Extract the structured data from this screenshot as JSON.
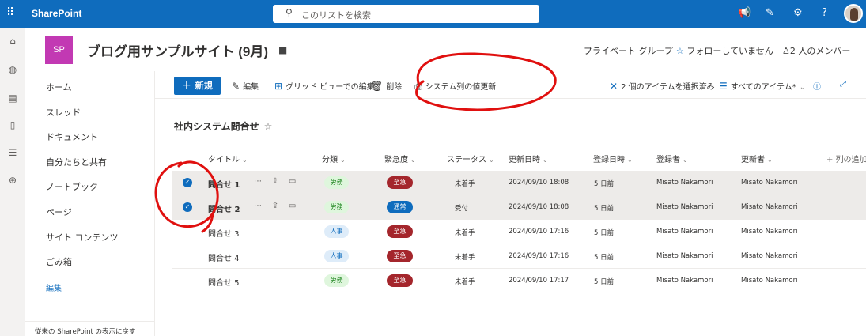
{
  "topbar": {
    "brand": "SharePoint",
    "search_placeholder": "このリストを検索",
    "color": "#0f6cbd"
  },
  "site": {
    "logo_text": "SP",
    "title": "ブログ用サンプルサイト (9月)",
    "group_label": "プライベート グループ",
    "follow_label": "フォローしていません",
    "members_label": "2 人のメンバー"
  },
  "nav": {
    "items": [
      "ホーム",
      "スレッド",
      "ドキュメント",
      "自分たちと共有",
      "ノートブック",
      "ページ",
      "サイト コンテンツ",
      "ごみ箱"
    ],
    "edit_label": "編集",
    "classic_link": "従来の SharePoint の表示に戻す"
  },
  "commands": {
    "new_label": "新規",
    "edit_label": "編集",
    "grid_label": "グリッド ビューでの編集",
    "delete_label": "削除",
    "system_label": "システム列の値更新",
    "selected_label": "2 個のアイテムを選択済み",
    "view_label": "すべてのアイテム*"
  },
  "list": {
    "title": "社内システム問合せ",
    "columns": {
      "title": "タイトル",
      "category": "分類",
      "urgency": "緊急度",
      "status": "ステータス",
      "modified": "更新日時",
      "created": "登録日時",
      "author": "登録者",
      "editor": "更新者",
      "add": "列の追加"
    },
    "rows": [
      {
        "title": "問合せ 1",
        "category": "労務",
        "urgency": "至急",
        "status": "未着手",
        "modified": "2024/09/10 18:08",
        "created": "5 日前",
        "author": "Misato Nakamori",
        "editor": "Misato Nakamori",
        "selected": true
      },
      {
        "title": "問合せ 2",
        "category": "労務",
        "urgency": "通常",
        "status": "受付",
        "modified": "2024/09/10 18:08",
        "created": "5 日前",
        "author": "Misato Nakamori",
        "editor": "Misato Nakamori",
        "selected": true
      },
      {
        "title": "問合せ 3",
        "category": "人事",
        "urgency": "至急",
        "status": "未着手",
        "modified": "2024/09/10 17:16",
        "created": "5 日前",
        "author": "Misato Nakamori",
        "editor": "Misato Nakamori",
        "selected": false
      },
      {
        "title": "問合せ 4",
        "category": "人事",
        "urgency": "至急",
        "status": "未着手",
        "modified": "2024/09/10 17:16",
        "created": "5 日前",
        "author": "Misato Nakamori",
        "editor": "Misato Nakamori",
        "selected": false
      },
      {
        "title": "問合せ 5",
        "category": "労務",
        "urgency": "至急",
        "status": "未着手",
        "modified": "2024/09/10 17:17",
        "created": "5 日前",
        "author": "Misato Nakamori",
        "editor": "Misato Nakamori",
        "selected": false
      }
    ]
  },
  "colors": {
    "roumu_bg": "#dff6dd",
    "roumu_fg": "#107c10",
    "jinji_bg": "#deecf9",
    "jinji_fg": "#0f6cbd",
    "urgent": "#a4262c",
    "normal": "#0f6cbd",
    "annotation": "#e0100f"
  }
}
